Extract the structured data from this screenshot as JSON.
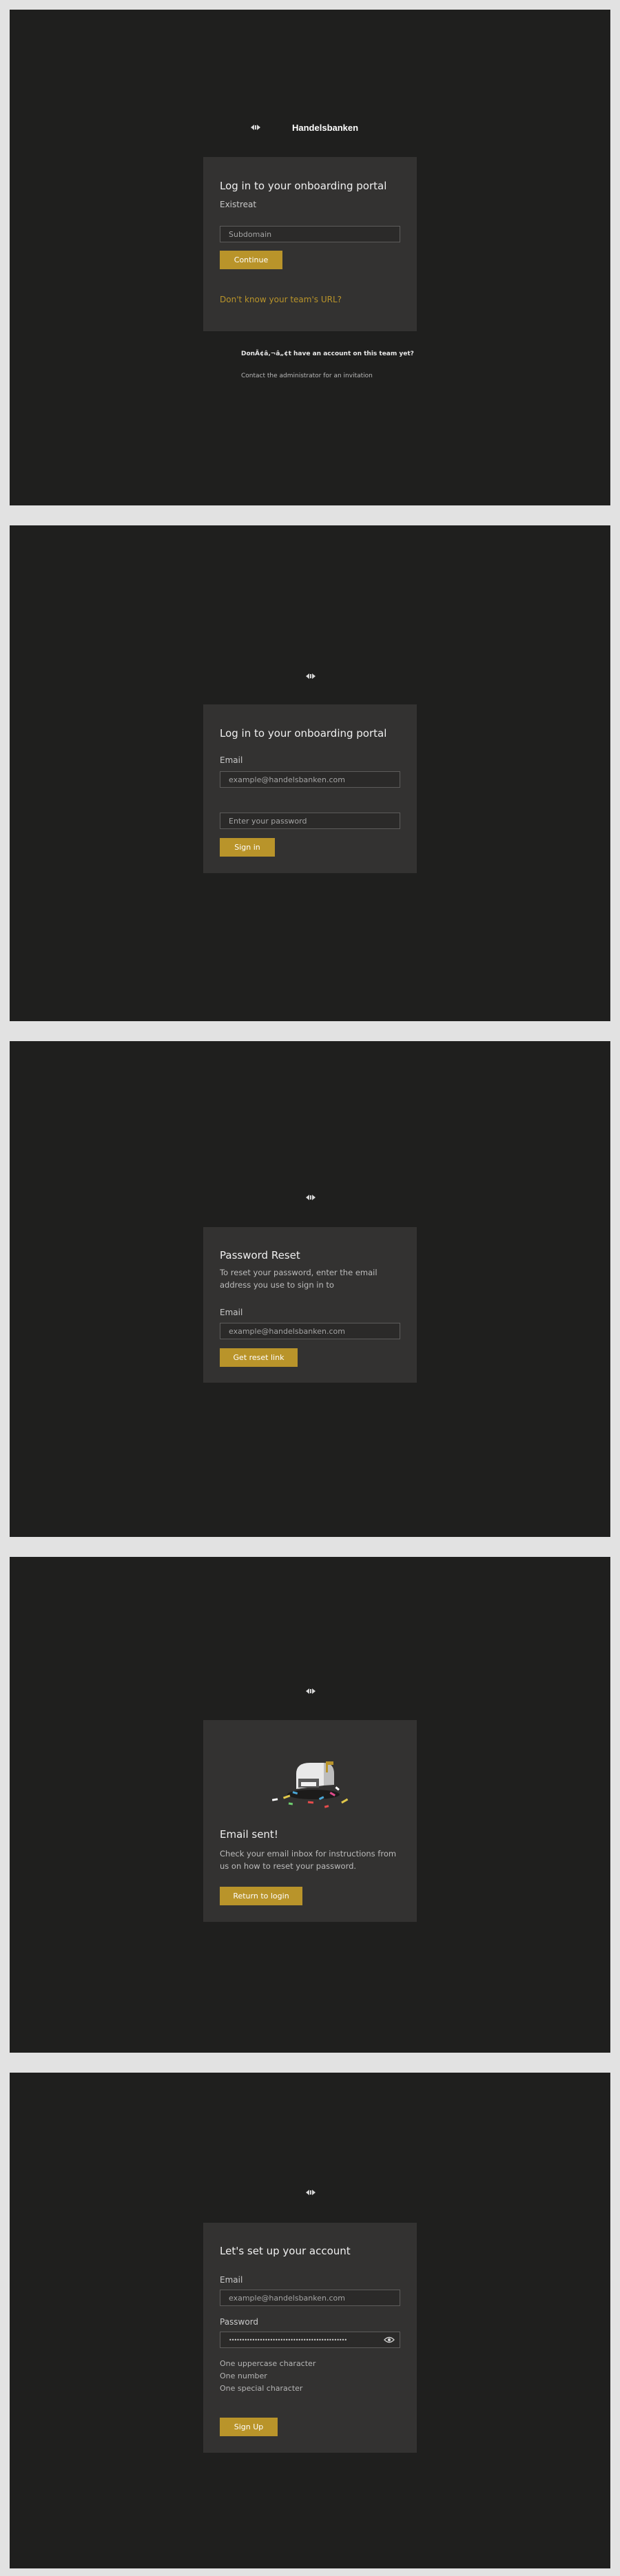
{
  "brand": {
    "name": "Handelsbanken",
    "logo_icon": "handelsbanken-logo-icon"
  },
  "colors": {
    "screen_bg": "#1f1f1e",
    "card_bg": "#333231",
    "accent": "#b9942a",
    "link": "#b9942a"
  },
  "screen1": {
    "title": "Log in to your onboarding portal",
    "label": "Existreat",
    "subdomain_placeholder": "Subdomain",
    "continue_label": "Continue",
    "forgot_url_link": "Don't know your team's URL?",
    "no_account_heading": "DonÃ¢â‚¬â„¢t have an account on this team yet?",
    "no_account_text": "Contact the administrator for an invitation"
  },
  "screen2": {
    "title": "Log in to your onboarding portal",
    "email_label": "Email",
    "email_placeholder": "example@handelsbanken.com",
    "password_placeholder": "Enter your password",
    "sign_in_label": "Sign in"
  },
  "screen3": {
    "title": "Password Reset",
    "description": "To reset your password, enter the email address you use to sign in to",
    "email_label": "Email",
    "email_placeholder": "example@handelsbanken.com",
    "button_label": "Get reset link"
  },
  "screen4": {
    "illustration": "mailbox-confetti-illustration",
    "title": "Email sent!",
    "description": "Check your email inbox for instructions from us on how to reset your password.",
    "button_label": "Return to login"
  },
  "screen5": {
    "title": "Let's set up your account",
    "email_label": "Email",
    "email_placeholder": "example@handelsbanken.com",
    "password_label": "Password",
    "password_value": "••••••••••••••••••••••••••••••••••••••••••••••",
    "eye_icon": "eye-icon",
    "requirements": [
      "One uppercase character",
      "One number",
      "One special character"
    ],
    "button_label": "Sign Up"
  }
}
